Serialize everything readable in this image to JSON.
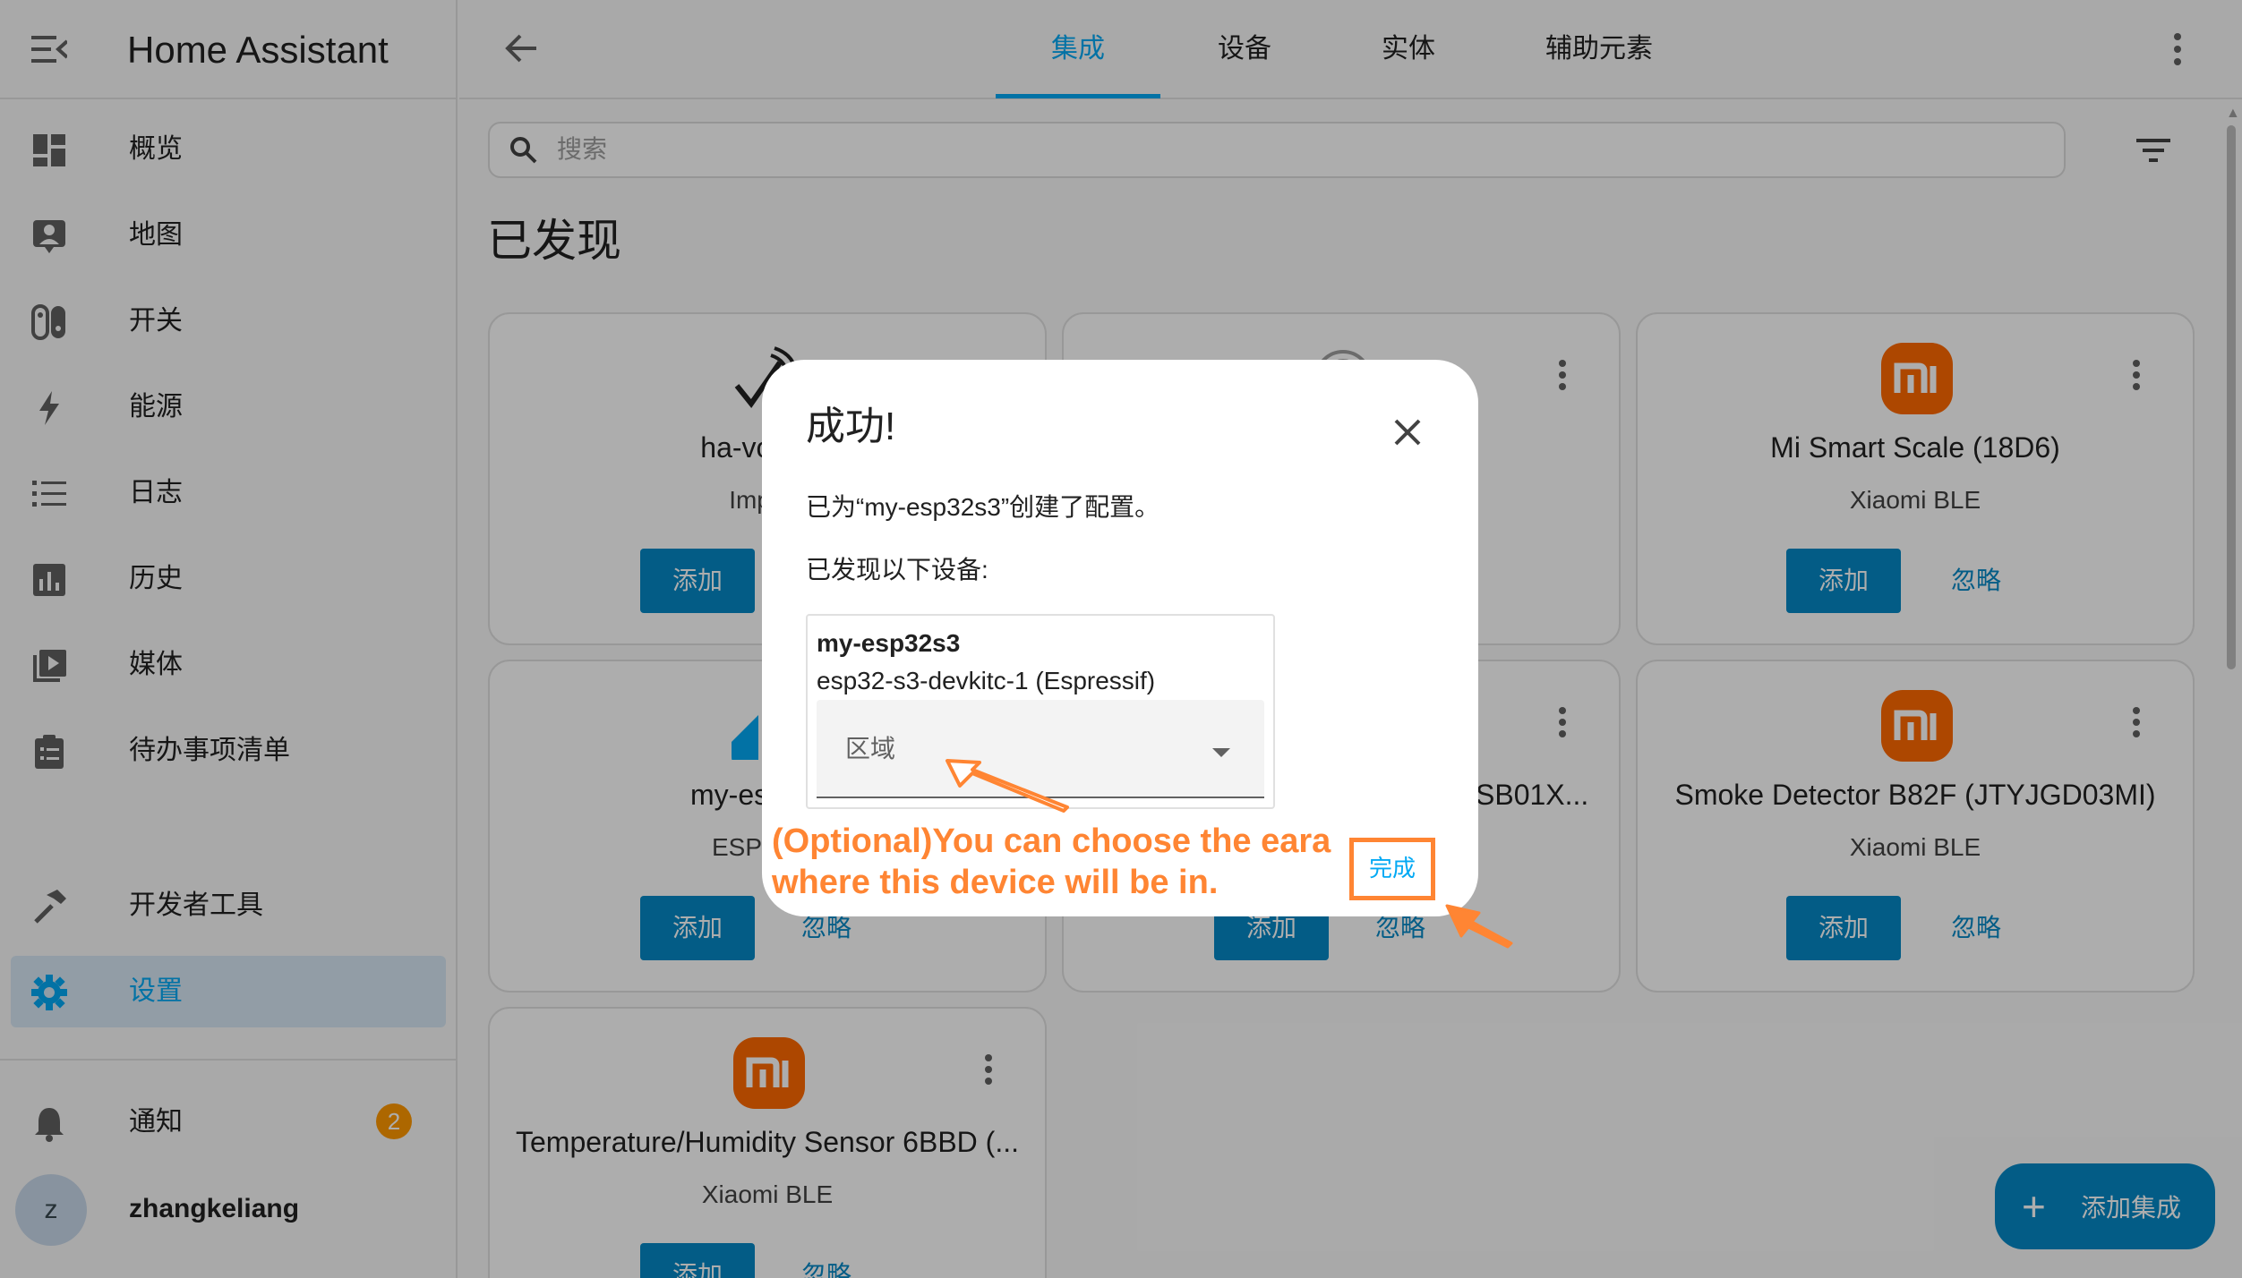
{
  "app": {
    "title": "Home Assistant"
  },
  "sidebar": {
    "items": [
      {
        "label": "概览",
        "icon": "dashboard-icon"
      },
      {
        "label": "地图",
        "icon": "map-icon"
      },
      {
        "label": "开关",
        "icon": "switch-icon"
      },
      {
        "label": "能源",
        "icon": "lightning-icon"
      },
      {
        "label": "日志",
        "icon": "list-icon"
      },
      {
        "label": "历史",
        "icon": "chart-icon"
      },
      {
        "label": "媒体",
        "icon": "media-icon"
      },
      {
        "label": "待办事项清单",
        "icon": "clipboard-icon"
      }
    ],
    "dev_tools": "开发者工具",
    "settings": "设置",
    "notifications": "通知",
    "notification_count": "2",
    "user_initial": "z",
    "user_name": "zhangkeliang"
  },
  "tabs": [
    "集成",
    "设备",
    "实体",
    "辅助元素"
  ],
  "search": {
    "placeholder": "搜索"
  },
  "section_title": "已发现",
  "cards": [
    {
      "name": "ha-voice-p",
      "sub": "Improv",
      "add": "添加",
      "ignore": ""
    },
    {
      "name": "",
      "sub": "",
      "add": "",
      "ignore": ""
    },
    {
      "name": "Mi Smart Scale (18D6)",
      "sub": "Xiaomi BLE",
      "add": "添加",
      "ignore": "忽略"
    },
    {
      "name": "my-es",
      "sub": "ESPH",
      "add": "添加",
      "ignore": "忽略"
    },
    {
      "name": "SB01X...",
      "sub": "",
      "add": "添加",
      "ignore": "忽略"
    },
    {
      "name": "Smoke Detector B82F (JTYJGD03MI)",
      "sub": "Xiaomi BLE",
      "add": "添加",
      "ignore": "忽略"
    },
    {
      "name": "Temperature/Humidity Sensor 6BBD (...",
      "sub": "Xiaomi BLE",
      "add": "添加",
      "ignore": "忽略"
    }
  ],
  "dialog": {
    "title": "成功!",
    "message": "已为“my-esp32s3”创建了配置。",
    "devices_found": "已发现以下设备:",
    "device_name": "my-esp32s3",
    "device_model": "esp32-s3-devkitc-1 (Espressif)",
    "area_label": "区域",
    "done": "完成"
  },
  "annotation": {
    "line1": "(Optional)You can choose the eara",
    "line2": "where this device will be in."
  },
  "fab": {
    "label": "添加集成"
  },
  "colors": {
    "accent": "#03a9f4",
    "primary_button": "#0588c6",
    "xiaomi": "#ff6900",
    "annotation": "#ff8533",
    "badge": "#ff9800"
  }
}
